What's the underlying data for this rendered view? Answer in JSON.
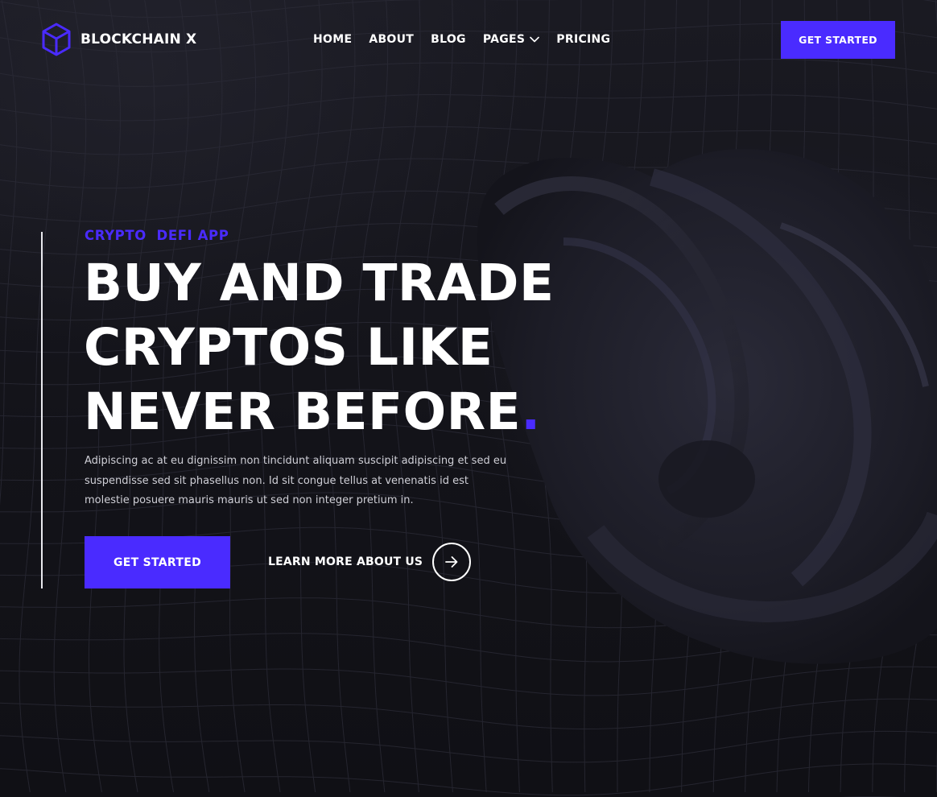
{
  "brand": {
    "name": "BLOCKCHAIN X",
    "icon": "cube-icon",
    "accent_color": "#4a2bff"
  },
  "nav": {
    "items": [
      {
        "label": "HOME"
      },
      {
        "label": "ABOUT"
      },
      {
        "label": "BLOG"
      },
      {
        "label": "PAGES",
        "icon": "chevron-down-icon"
      },
      {
        "label": "PRICING"
      }
    ],
    "cta_label": "GET STARTED"
  },
  "hero": {
    "eyebrow": "CRYPTO  DEFI APP",
    "headline_lines": [
      "BUY AND TRADE",
      "CRYPTOS LIKE",
      "NEVER BEFORE"
    ],
    "headline_suffix": ".",
    "description": "Adipiscing ac at eu dignissim non tincidunt aliquam suscipit adipiscing et sed eu suspendisse sed sit phasellus non. Id sit congue tellus at venenatis id est molestie posuere mauris mauris ut sed non integer pretium in.",
    "primary_cta": "GET STARTED",
    "secondary_cta": "LEARN MORE ABOUT US",
    "secondary_icon": "arrow-right-icon"
  },
  "colors": {
    "background": "#121218",
    "accent": "#4a2bff",
    "text": "#ffffff"
  }
}
